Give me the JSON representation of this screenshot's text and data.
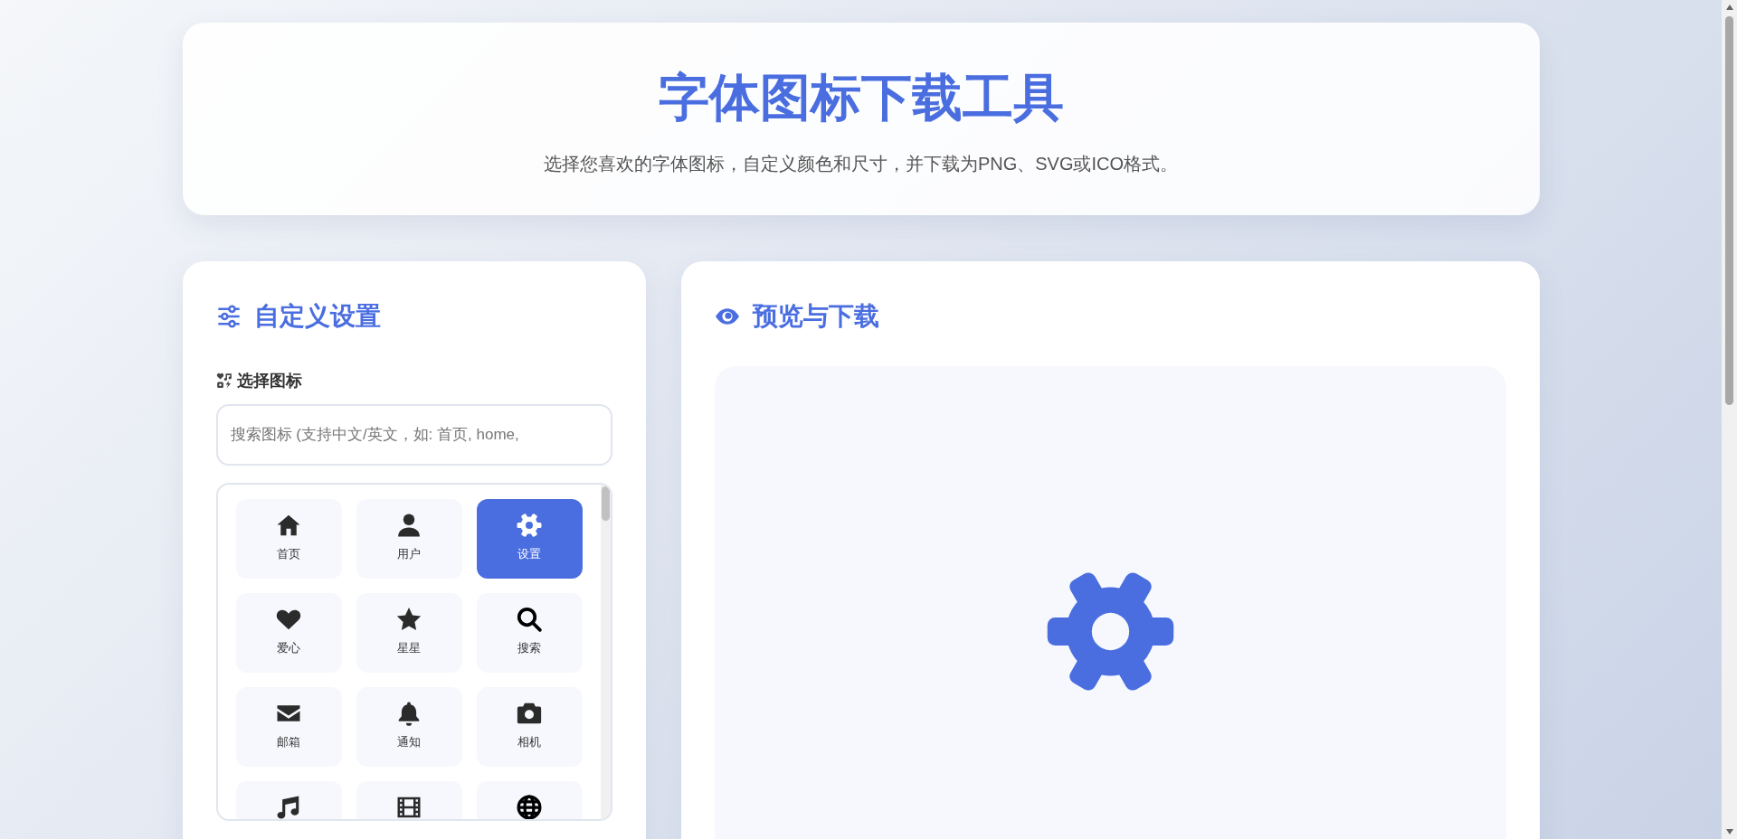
{
  "header": {
    "title": "字体图标下载工具",
    "subtitle": "选择您喜欢的字体图标，自定义颜色和尺寸，并下载为PNG、SVG或ICO格式。"
  },
  "settings": {
    "heading": "自定义设置",
    "icon_label": "选择图标",
    "search": {
      "placeholder": "搜索图标 (支持中文/英文，如: 首页, home,"
    },
    "icons": [
      {
        "kind": "home",
        "label": "首页",
        "selected": false
      },
      {
        "kind": "user",
        "label": "用户",
        "selected": false
      },
      {
        "kind": "gear",
        "label": "设置",
        "selected": true
      },
      {
        "kind": "heart",
        "label": "爱心",
        "selected": false
      },
      {
        "kind": "star",
        "label": "星星",
        "selected": false
      },
      {
        "kind": "search",
        "label": "搜索",
        "selected": false
      },
      {
        "kind": "mail",
        "label": "邮箱",
        "selected": false
      },
      {
        "kind": "bell",
        "label": "通知",
        "selected": false
      },
      {
        "kind": "camera",
        "label": "相机",
        "selected": false
      },
      {
        "kind": "music",
        "selected": false
      },
      {
        "kind": "film",
        "selected": false
      },
      {
        "kind": "globe",
        "selected": false
      }
    ]
  },
  "preview": {
    "heading": "预览与下载",
    "kind": "gear"
  }
}
